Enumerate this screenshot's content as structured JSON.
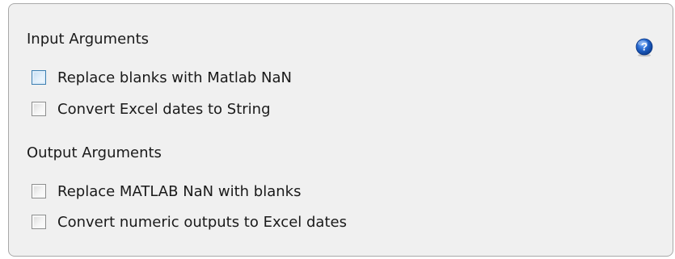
{
  "sections": [
    {
      "title": "Input Arguments",
      "options": [
        {
          "label": "Replace blanks with Matlab NaN",
          "checked": false,
          "hovered": true
        },
        {
          "label": "Convert Excel dates to String",
          "checked": false,
          "hovered": false
        }
      ]
    },
    {
      "title": "Output Arguments",
      "options": [
        {
          "label": "Replace MATLAB NaN with blanks",
          "checked": false,
          "hovered": false
        },
        {
          "label": "Convert numeric outputs to Excel dates",
          "checked": false,
          "hovered": false
        }
      ]
    }
  ],
  "help": {
    "icon": "help-icon",
    "glyph": "?",
    "color": "#1f5fc4"
  }
}
